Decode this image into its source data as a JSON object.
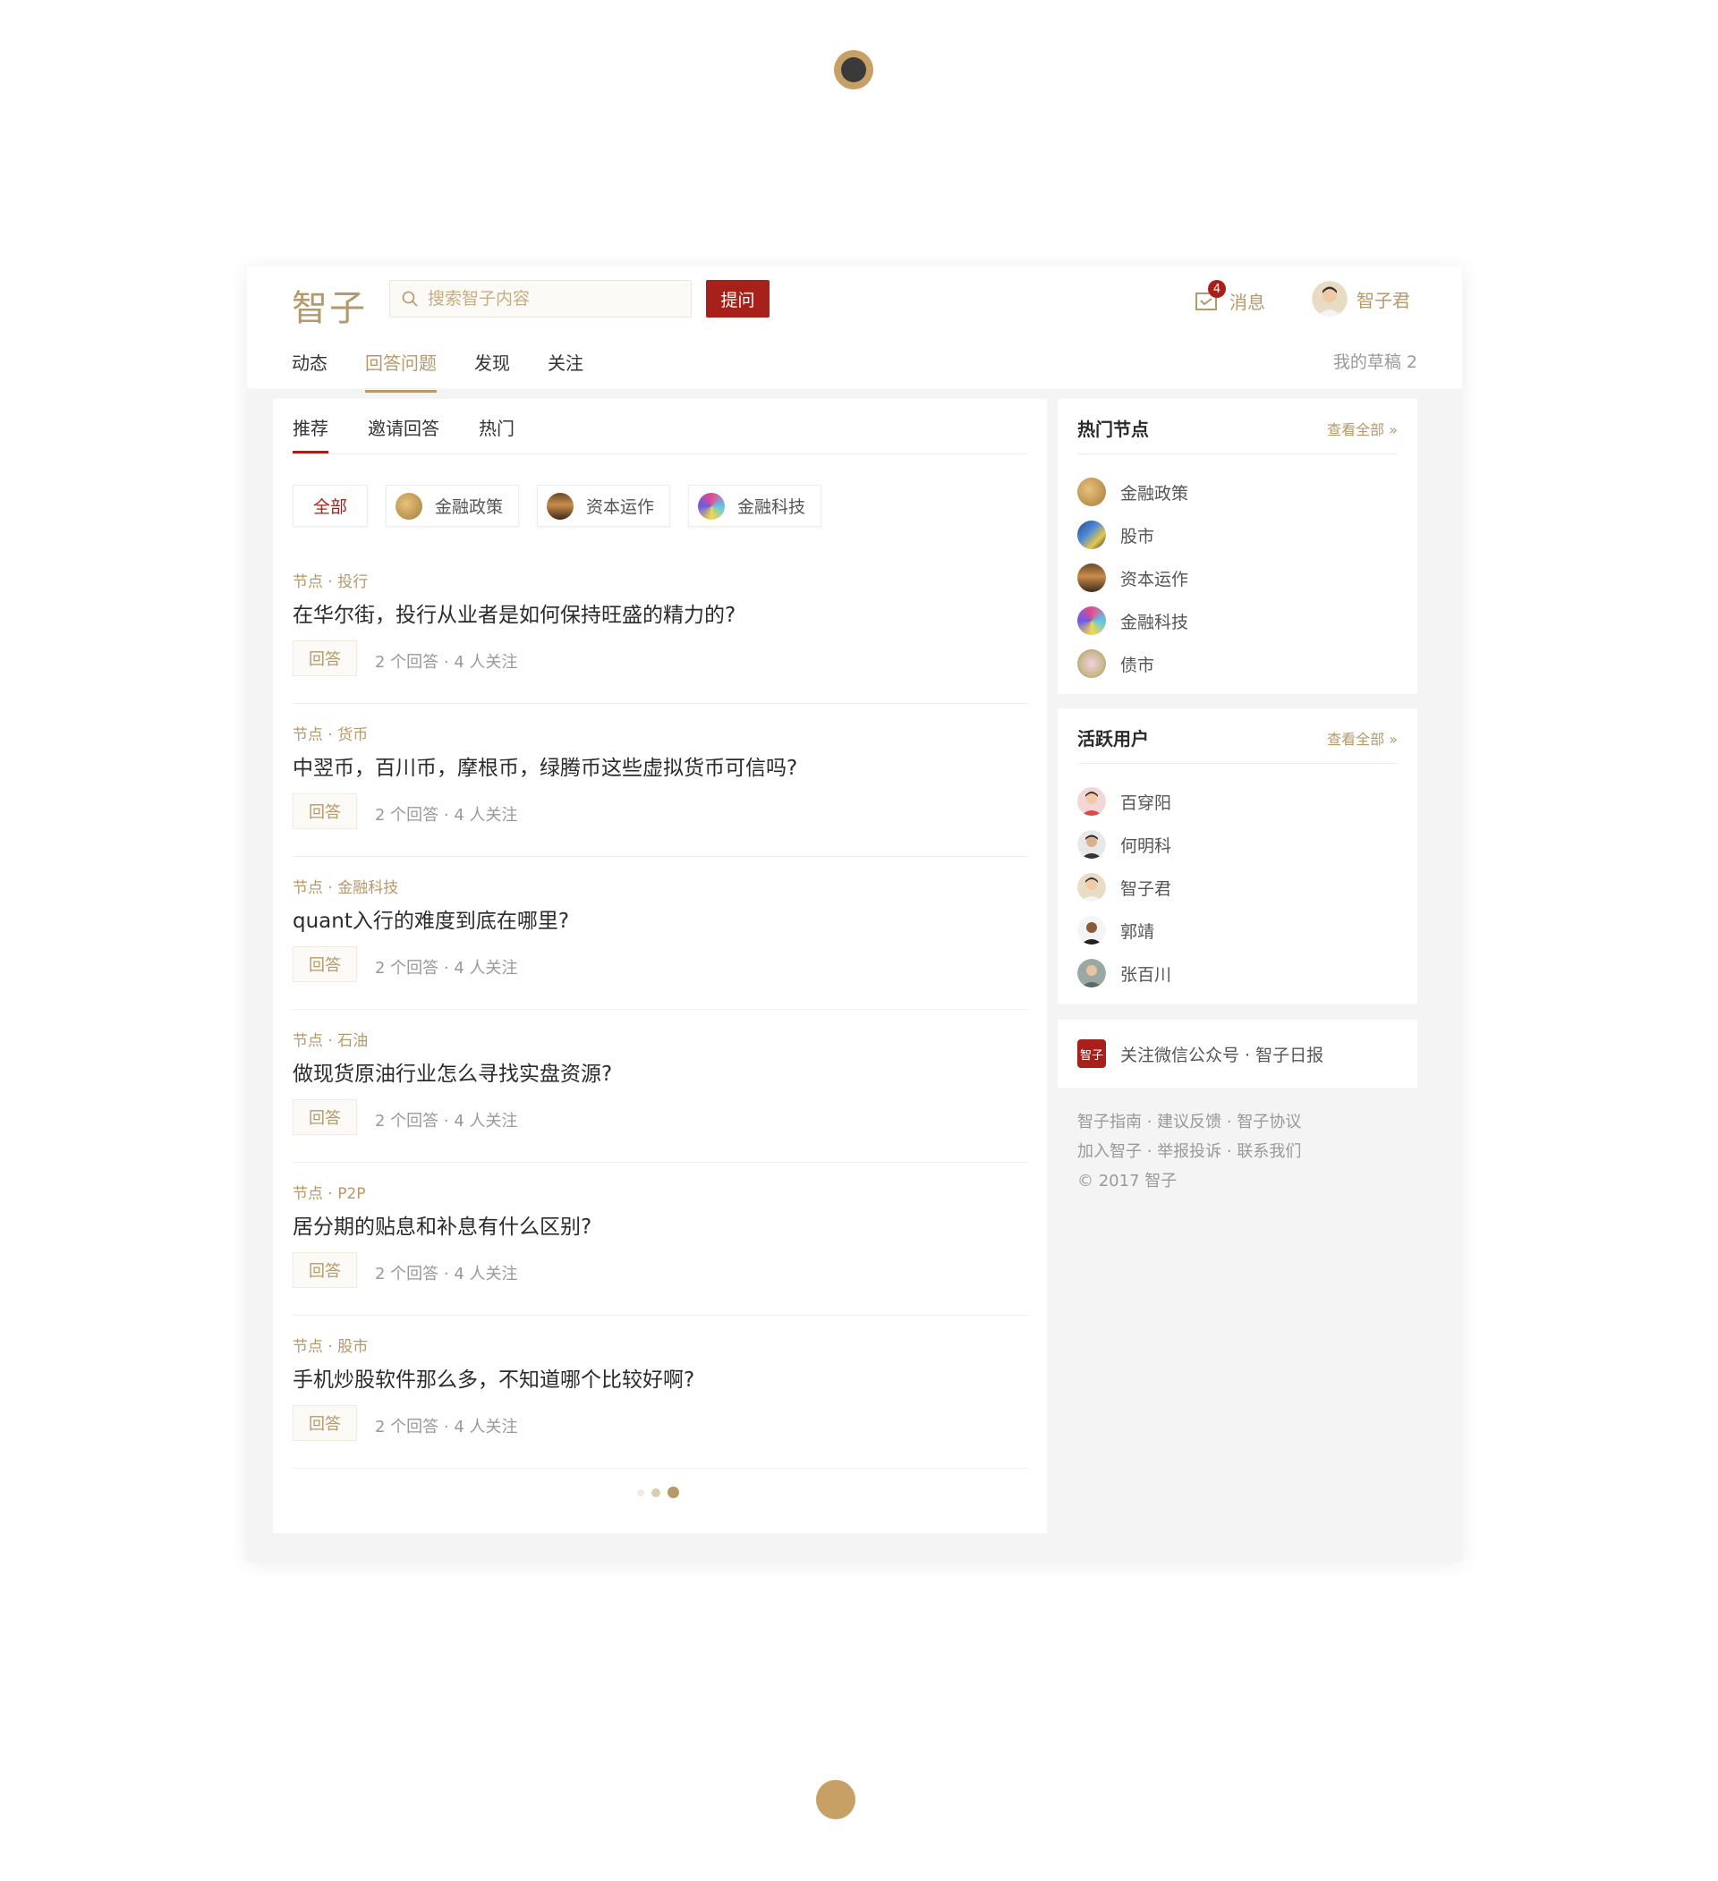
{
  "app": {
    "logo": "智子"
  },
  "header": {
    "search_placeholder": "搜索智子内容",
    "ask_label": "提问",
    "messages_label": "消息",
    "messages_count": "4",
    "user_name": "智子君",
    "drafts_label": "我的草稿 2"
  },
  "nav": {
    "tabs": [
      "动态",
      "回答问题",
      "发现",
      "关注"
    ],
    "active_index": 1
  },
  "subtabs": {
    "items": [
      "推荐",
      "邀请回答",
      "热门"
    ],
    "active_index": 0
  },
  "chips": [
    "全部",
    "金融政策",
    "资本运作",
    "金融科技"
  ],
  "questions": [
    {
      "node": "节点 · 投行",
      "title": "在华尔街，投行从业者是如何保持旺盛的精力的?",
      "answer_label": "回答",
      "stats": "2 个回答 · 4 人关注"
    },
    {
      "node": "节点 · 货币",
      "title": "中翌币，百川币，摩根币，绿腾币这些虚拟货币可信吗?",
      "answer_label": "回答",
      "stats": "2 个回答 · 4 人关注"
    },
    {
      "node": "节点 · 金融科技",
      "title": "quant入行的难度到底在哪里?",
      "answer_label": "回答",
      "stats": "2 个回答 · 4 人关注"
    },
    {
      "node": "节点 · 石油",
      "title": "做现货原油行业怎么寻找实盘资源?",
      "answer_label": "回答",
      "stats": "2 个回答 · 4 人关注"
    },
    {
      "node": "节点 · P2P",
      "title": "居分期的贴息和补息有什么区别?",
      "answer_label": "回答",
      "stats": "2 个回答 · 4 人关注"
    },
    {
      "node": "节点 · 股市",
      "title": "手机炒股软件那么多，不知道哪个比较好啊?",
      "answer_label": "回答",
      "stats": "2 个回答 · 4 人关注"
    }
  ],
  "hot_nodes": {
    "title": "热门节点",
    "more": "查看全部 »",
    "items": [
      "金融政策",
      "股市",
      "资本运作",
      "金融科技",
      "债市"
    ]
  },
  "active_users": {
    "title": "活跃用户",
    "more": "查看全部 »",
    "items": [
      "百穿阳",
      "何明科",
      "智子君",
      "郭靖",
      "张百川"
    ]
  },
  "wechat": {
    "logo_text": "智子",
    "label": "关注微信公众号 · 智子日报"
  },
  "footer": {
    "line1": "智子指南 · 建议反馈 · 智子协议",
    "line2": "加入智子 · 举报投诉 · 联系我们",
    "line3": "© 2017 智子"
  },
  "colors": {
    "accent": "#b5996a",
    "brand_red": "#a8201a",
    "bg": "#f4f4f4"
  }
}
